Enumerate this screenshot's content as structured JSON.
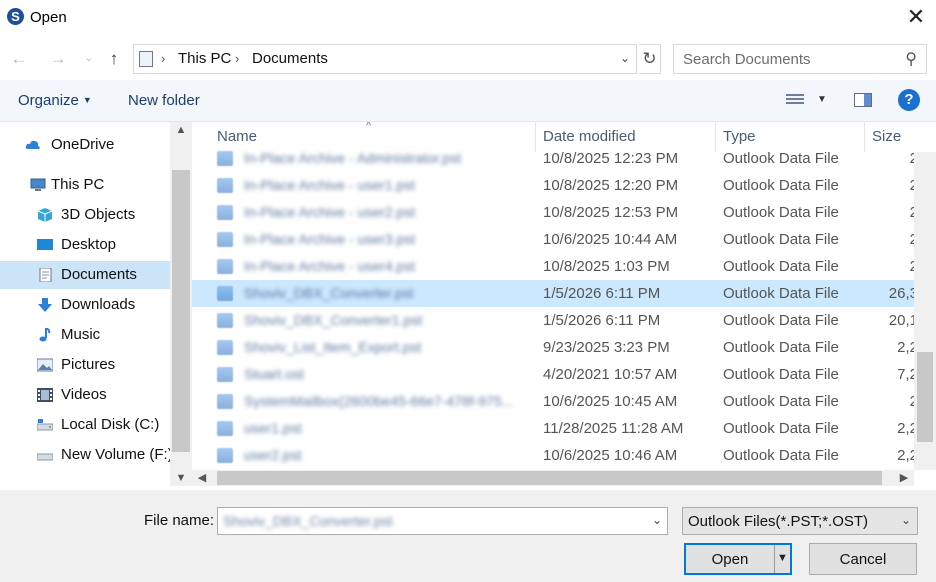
{
  "window": {
    "title": "Open",
    "app_icon_letter": "S",
    "close_glyph": "✕"
  },
  "navigation": {
    "back_glyph": "←",
    "forward_glyph": "→",
    "recent_glyph": "⌄",
    "up_glyph": "↑",
    "breadcrumb": [
      "This PC",
      "Documents"
    ],
    "breadcrumb_separator": "›",
    "refresh_glyph": "↻",
    "search_placeholder": "Search Documents",
    "search_glyph": "⚲"
  },
  "toolbar": {
    "organize_label": "Organize",
    "new_folder_label": "New folder",
    "help_glyph": "?"
  },
  "sidebar": {
    "items": [
      {
        "label": "OneDrive",
        "icon": "cloud-icon",
        "color": "#2f7fd9"
      },
      {
        "label": "This PC",
        "icon": "computer-icon",
        "color": "#4a86c9"
      },
      {
        "label": "3D Objects",
        "icon": "cube-icon",
        "color": "#35a6d8"
      },
      {
        "label": "Desktop",
        "icon": "desktop-icon",
        "color": "#1e88d6"
      },
      {
        "label": "Documents",
        "icon": "document-icon",
        "color": "#8a96a6",
        "selected": true
      },
      {
        "label": "Downloads",
        "icon": "download-icon",
        "color": "#2f7fd9"
      },
      {
        "label": "Music",
        "icon": "music-icon",
        "color": "#2f7fd9"
      },
      {
        "label": "Pictures",
        "icon": "picture-icon",
        "color": "#5a7fa8"
      },
      {
        "label": "Videos",
        "icon": "film-icon",
        "color": "#3e4f66"
      },
      {
        "label": "Local Disk (C:)",
        "icon": "drive-icon",
        "color": "#8b98a8"
      },
      {
        "label": "New Volume (F:)",
        "icon": "drive-icon",
        "color": "#8b98a8"
      }
    ]
  },
  "file_list": {
    "columns": {
      "name": "Name",
      "date": "Date modified",
      "type": "Type",
      "size": "Size"
    },
    "sort_glyph": "^",
    "rows": [
      {
        "name": "In-Place Archive - Administrator.pst",
        "date": "10/8/2025 12:23 PM",
        "type": "Outlook Data File",
        "size": "2"
      },
      {
        "name": "In-Place Archive - user1.pst",
        "date": "10/8/2025 12:20 PM",
        "type": "Outlook Data File",
        "size": "2"
      },
      {
        "name": "In-Place Archive - user2.pst",
        "date": "10/8/2025 12:53 PM",
        "type": "Outlook Data File",
        "size": "2"
      },
      {
        "name": "In-Place Archive - user3.pst",
        "date": "10/6/2025 10:44 AM",
        "type": "Outlook Data File",
        "size": "2"
      },
      {
        "name": "In-Place Archive - user4.pst",
        "date": "10/8/2025 1:03 PM",
        "type": "Outlook Data File",
        "size": "2"
      },
      {
        "name": "Shoviv_DBX_Converter.pst",
        "date": "1/5/2026 6:11 PM",
        "type": "Outlook Data File",
        "size": "26,3",
        "selected": true
      },
      {
        "name": "Shoviv_DBX_Converter1.pst",
        "date": "1/5/2026 6:11 PM",
        "type": "Outlook Data File",
        "size": "20,1"
      },
      {
        "name": "Shoviv_List_Item_Export.pst",
        "date": "9/23/2025 3:23 PM",
        "type": "Outlook Data File",
        "size": "2,2"
      },
      {
        "name": "Stuart.ost",
        "date": "4/20/2021 10:57 AM",
        "type": "Outlook Data File",
        "size": "7,2"
      },
      {
        "name": "SystemMailbox{2600be45-66e7-478f-975...",
        "date": "10/6/2025 10:45 AM",
        "type": "Outlook Data File",
        "size": "2"
      },
      {
        "name": "user1.pst",
        "date": "11/28/2025 11:28 AM",
        "type": "Outlook Data File",
        "size": "2,2"
      },
      {
        "name": "user2.pst",
        "date": "10/6/2025 10:46 AM",
        "type": "Outlook Data File",
        "size": "2,2"
      }
    ]
  },
  "footer": {
    "file_name_label": "File name:",
    "file_name_value": "Shoviv_DBX_Converter.pst",
    "file_type_value": "Outlook Files(*.PST;*.OST)",
    "open_label": "Open",
    "cancel_label": "Cancel",
    "dropdown_glyph": "⌄"
  },
  "colors": {
    "accent": "#0078d7",
    "selection": "#cce8ff",
    "sidebar_selection": "#cce4f7"
  }
}
